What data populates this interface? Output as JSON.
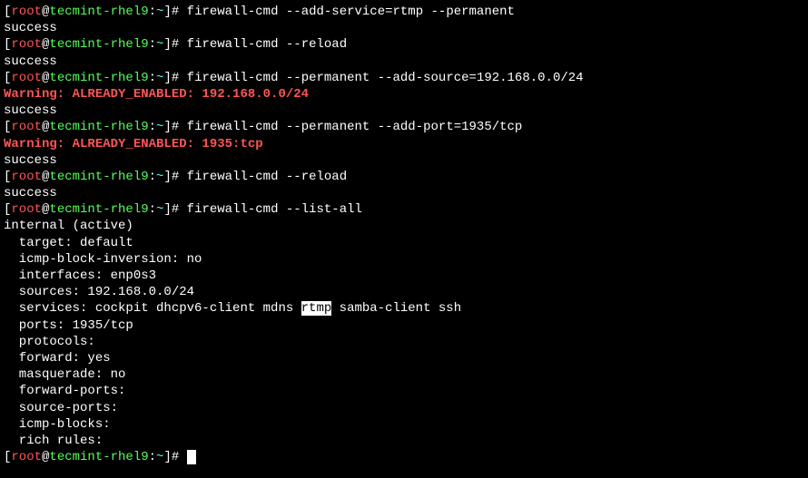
{
  "prompt": {
    "open": "[",
    "root": "root",
    "at": "@",
    "host": "tecmint-rhel9",
    "colon": ":",
    "path": "~",
    "close": "]",
    "hash": "# "
  },
  "commands": {
    "cmd1": "firewall-cmd --add-service=rtmp --permanent",
    "cmd2": "firewall-cmd --reload",
    "cmd3": "firewall-cmd --permanent --add-source=192.168.0.0/24",
    "cmd4": "firewall-cmd --permanent --add-port=1935/tcp",
    "cmd5": "firewall-cmd --reload",
    "cmd6": "firewall-cmd --list-all"
  },
  "outputs": {
    "success": "success",
    "warn1": "Warning: ALREADY_ENABLED: 192.168.0.0/24",
    "warn2": "Warning: ALREADY_ENABLED: 1935:tcp"
  },
  "listall": {
    "zone": "internal (active)",
    "target": "  target: default",
    "icmp_inv": "  icmp-block-inversion: no",
    "interfaces": "  interfaces: enp0s3",
    "sources": "  sources: 192.168.0.0/24",
    "services_pre": "  services: cockpit dhcpv6-client mdns ",
    "services_hl": "rtmp",
    "services_post": " samba-client ssh",
    "ports": "  ports: 1935/tcp",
    "protocols": "  protocols:",
    "forward": "  forward: yes",
    "masquerade": "  masquerade: no",
    "forward_ports": "  forward-ports:",
    "source_ports": "  source-ports:",
    "icmp_blocks": "  icmp-blocks:",
    "rich_rules": "  rich rules:"
  }
}
